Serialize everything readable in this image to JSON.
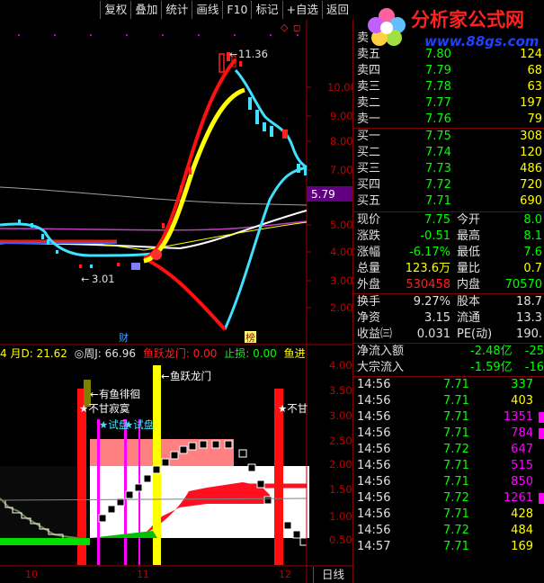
{
  "toolbar": [
    "复权",
    "叠加",
    "统计",
    "画线",
    "F10",
    "标记",
    "+自选",
    "返回"
  ],
  "logo": {
    "text": "分析家公式网",
    "url": "www.88gs.com"
  },
  "main_chart": {
    "price_axis": [
      "10.00",
      "9.00",
      "8.00",
      "7.00",
      "6.00",
      "5.00",
      "4.00",
      "3.00",
      "2.00"
    ],
    "current_price_tag": "5.79",
    "high_label": "11.36",
    "low_label": "3.01",
    "event_labels": [
      "财",
      "榜"
    ]
  },
  "indicator_bar": {
    "left": "4 月D",
    "d_value": ": 21.62",
    "week_label": "◎周J",
    "week_value": ": 66.96",
    "fish_gate": "鱼跃龙门: 0.00",
    "stop_loss": "止损: 0.00",
    "fish_in": "鱼进"
  },
  "sub_chart": {
    "axis": [
      "4.00",
      "3.50",
      "3.00",
      "2.50",
      "2.00",
      "1.50",
      "1.00",
      "0.50"
    ],
    "x_labels": [
      "10",
      "11",
      "12"
    ],
    "annotations": [
      "有鱼徘徊",
      "鱼跃龙门",
      "★不甘寂寞",
      "★试盘",
      "★试盘",
      "★不甘"
    ]
  },
  "period_button": "日线",
  "quotes": {
    "sell_header": "卖",
    "sell": [
      {
        "label": "卖五",
        "price": "7.80",
        "vol": "124"
      },
      {
        "label": "卖四",
        "price": "7.79",
        "vol": "68"
      },
      {
        "label": "卖三",
        "price": "7.78",
        "vol": "63"
      },
      {
        "label": "卖二",
        "price": "7.77",
        "vol": "197"
      },
      {
        "label": "卖一",
        "price": "7.76",
        "vol": "79"
      }
    ],
    "buy": [
      {
        "label": "买一",
        "price": "7.75",
        "vol": "308"
      },
      {
        "label": "买二",
        "price": "7.74",
        "vol": "120"
      },
      {
        "label": "买三",
        "price": "7.73",
        "vol": "486"
      },
      {
        "label": "买四",
        "price": "7.72",
        "vol": "720"
      },
      {
        "label": "买五",
        "price": "7.71",
        "vol": "690"
      }
    ]
  },
  "stats": [
    {
      "l1": "现价",
      "v1": "7.75",
      "c1": "#00ff00",
      "l2": "今开",
      "v2": "8.0",
      "c2": "#00ff00"
    },
    {
      "l1": "涨跌",
      "v1": "-0.51",
      "c1": "#00ff00",
      "l2": "最高",
      "v2": "8.1",
      "c2": "#00ff00"
    },
    {
      "l1": "涨幅",
      "v1": "-6.17%",
      "c1": "#00ff00",
      "l2": "最低",
      "v2": "7.6",
      "c2": "#00ff00"
    },
    {
      "l1": "总量",
      "v1": "123.6万",
      "c1": "#ffff00",
      "l2": "量比",
      "v2": "0.7",
      "c2": "#ffff00"
    },
    {
      "l1": "外盘",
      "v1": "530458",
      "c1": "#ff2020",
      "l2": "内盘",
      "v2": "70570",
      "c2": "#00ff00"
    }
  ],
  "stats2": [
    {
      "l1": "换手",
      "v1": "9.27%",
      "l2": "股本",
      "v2": "18.7"
    },
    {
      "l1": "净资",
      "v1": "3.15",
      "l2": "流通",
      "v2": "13.3"
    },
    {
      "l1": "收益㈢",
      "v1": "0.031",
      "l2": "PE(动)",
      "v2": "190."
    }
  ],
  "flows": [
    {
      "label": "净流入额",
      "v1": "-2.48亿",
      "v2": "-25"
    },
    {
      "label": "大宗流入",
      "v1": "-1.59亿",
      "v2": "-16"
    }
  ],
  "ticks": [
    {
      "t": "14:56",
      "p": "7.71",
      "v": "337",
      "vc": "#00ff00"
    },
    {
      "t": "14:56",
      "p": "7.71",
      "v": "403",
      "vc": "#ffff00"
    },
    {
      "t": "14:56",
      "p": "7.71",
      "v": "1351",
      "vc": "#ff00ff"
    },
    {
      "t": "14:56",
      "p": "7.71",
      "v": "784",
      "vc": "#ff00ff"
    },
    {
      "t": "14:56",
      "p": "7.72",
      "v": "647",
      "vc": "#ff00ff"
    },
    {
      "t": "14:56",
      "p": "7.71",
      "v": "515",
      "vc": "#ff00ff"
    },
    {
      "t": "14:56",
      "p": "7.71",
      "v": "850",
      "vc": "#ff00ff"
    },
    {
      "t": "14:56",
      "p": "7.72",
      "v": "1261",
      "vc": "#ff00ff"
    },
    {
      "t": "14:56",
      "p": "7.71",
      "v": "428",
      "vc": "#ffff00"
    },
    {
      "t": "14:56",
      "p": "7.72",
      "v": "484",
      "vc": "#ffff00"
    },
    {
      "t": "14:57",
      "p": "7.71",
      "v": "169",
      "vc": "#ffff00"
    }
  ]
}
